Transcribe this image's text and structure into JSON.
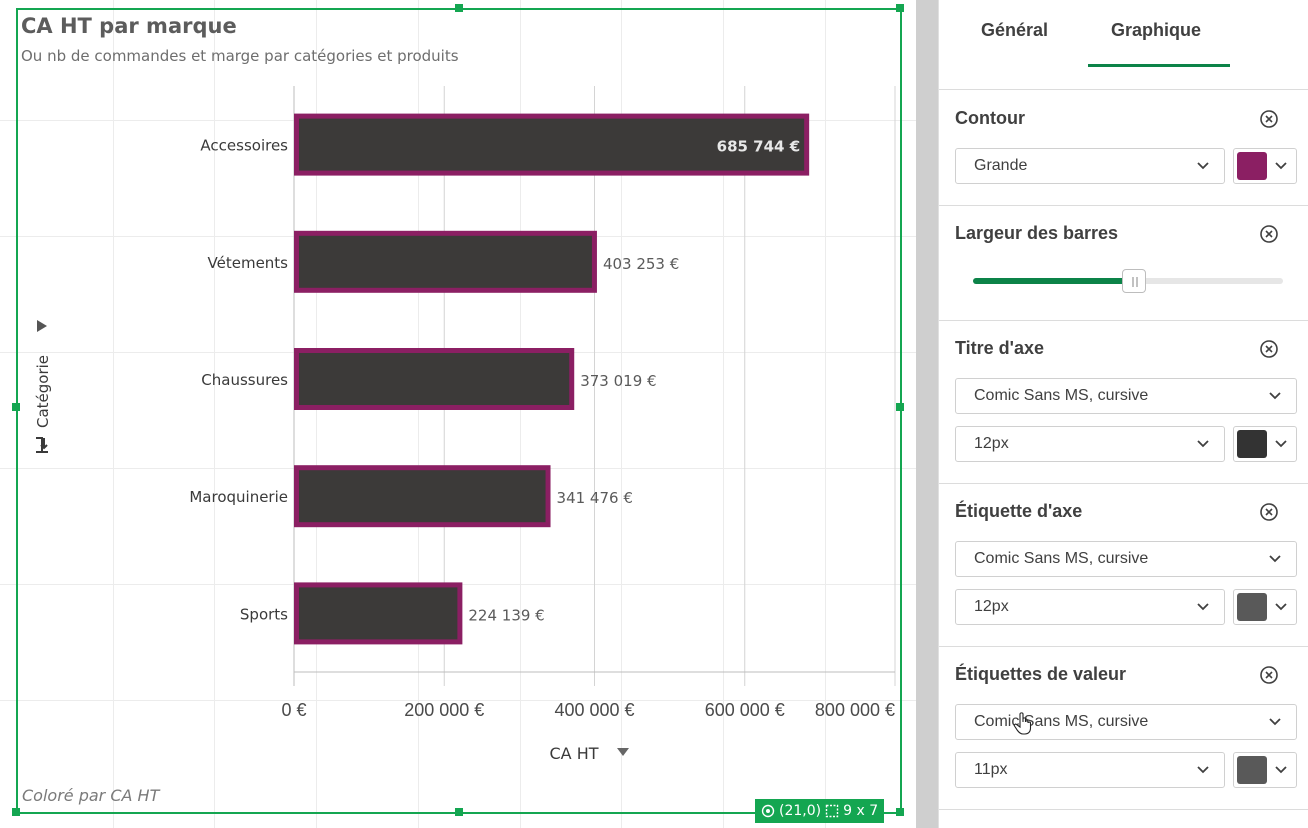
{
  "chart": {
    "title": "CA HT par marque",
    "subtitle": "Ou nb de commandes et marge par catégories et produits",
    "colored_by": "Coloré par CA HT",
    "y_axis_title": "Catégorie",
    "x_axis_title": "CA HT",
    "status_position": "(21,0)",
    "status_size": "9 x 7"
  },
  "chart_data": {
    "type": "bar",
    "orientation": "horizontal",
    "categories": [
      "Accessoires",
      "Vétements",
      "Chaussures",
      "Maroquinerie",
      "Sports"
    ],
    "values": [
      685744,
      403253,
      373019,
      341476,
      224139
    ],
    "value_labels": [
      "685 744 €",
      "403 253 €",
      "373 019 €",
      "341 476 €",
      "224 139 €"
    ],
    "xlabel": "CA HT",
    "ylabel": "Catégorie",
    "xlim": [
      0,
      800000
    ],
    "x_ticks": [
      0,
      200000,
      400000,
      600000,
      800000
    ],
    "x_tick_labels": [
      "0 €",
      "200 000 €",
      "400 000 €",
      "600 000 €",
      "800 000 €"
    ],
    "bar_color": "#3c3a39",
    "outline_color": "#8b1f63",
    "grid": true
  },
  "panel": {
    "tabs": [
      "Général",
      "Graphique"
    ],
    "active_tab": "Graphique",
    "sections": {
      "contour": {
        "title": "Contour",
        "select_value": "Grande",
        "color": "#8b1f63"
      },
      "bar_width": {
        "title": "Largeur des barres",
        "value_fraction": 0.52
      },
      "axis_title": {
        "title": "Titre d'axe",
        "font": "Comic Sans MS, cursive",
        "size": "12px",
        "color": "#333333"
      },
      "axis_label": {
        "title": "Étiquette d'axe",
        "font": "Comic Sans MS, cursive",
        "size": "12px",
        "color": "#595959"
      },
      "value_labels": {
        "title": "Étiquettes de valeur",
        "font": "Comic Sans MS, cursive",
        "size": "11px",
        "color": "#595959"
      }
    }
  }
}
